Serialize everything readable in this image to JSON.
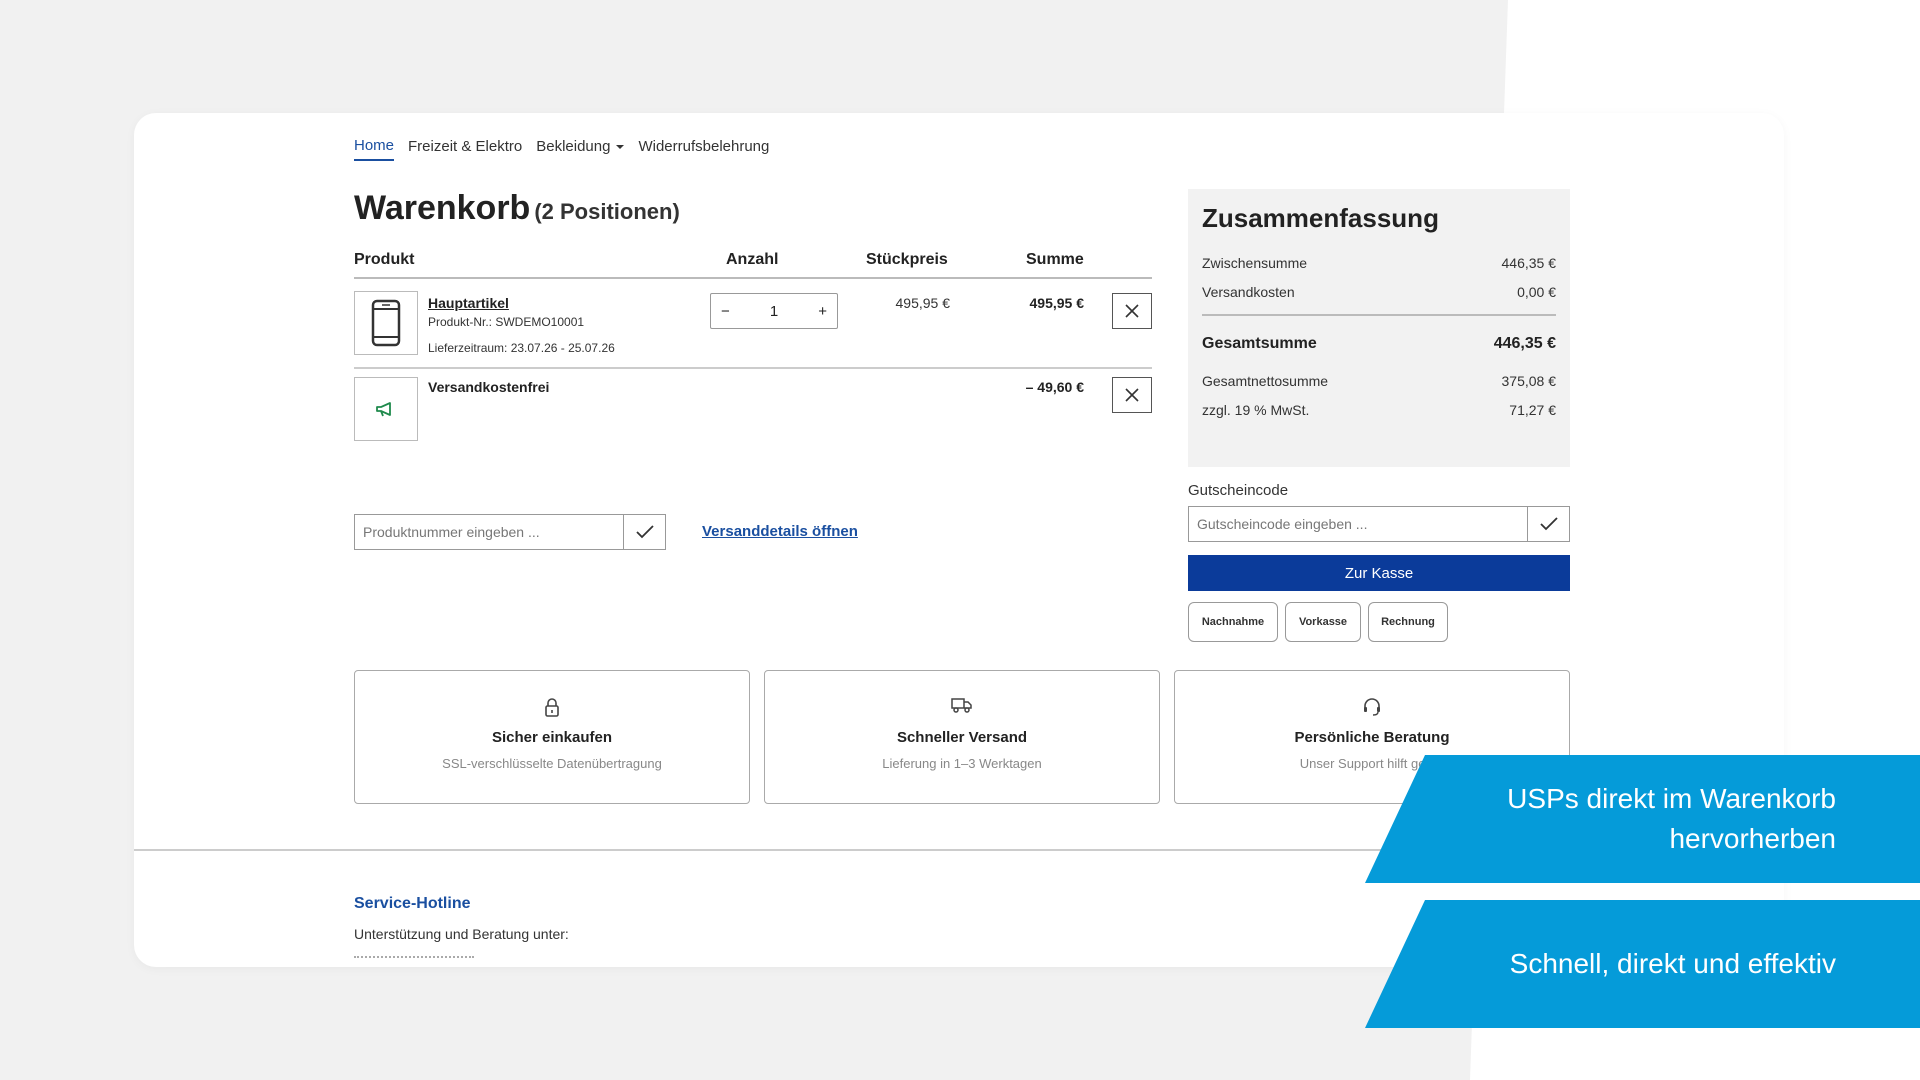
{
  "nav": [
    "Home",
    "Freizeit & Elektro",
    "Bekleidung",
    "Widerrufsbelehrung"
  ],
  "cart": {
    "title": "Warenkorb",
    "count": "(2 Positionen)",
    "columns": {
      "product": "Produkt",
      "qty": "Anzahl",
      "unit": "Stückpreis",
      "sum": "Summe"
    },
    "items": [
      {
        "name": "Hauptartikel",
        "sku": "Produkt-Nr.: SWDEMO10001",
        "delivery": "Lieferzeitraum: 23.07.26 - 25.07.26",
        "qty": "1",
        "unit": "495,95 €",
        "sum": "495,95 €"
      },
      {
        "name": "Versandkostenfrei",
        "sum": "– 49,60 €"
      }
    ],
    "product_input_placeholder": "Produktnummer eingeben ...",
    "shipping_link": "Versanddetails öffnen"
  },
  "summary": {
    "title": "Zusammenfassung",
    "rows": [
      {
        "label": "Zwischensumme",
        "value": "446,35 €"
      },
      {
        "label": "Versandkosten",
        "value": "0,00 €"
      }
    ],
    "total": {
      "label": "Gesamtsumme",
      "value": "446,35 €"
    },
    "net_rows": [
      {
        "label": "Gesamtnettosumme",
        "value": "375,08 €"
      },
      {
        "label": "zzgl. 19 % MwSt.",
        "value": "71,27 €"
      }
    ]
  },
  "voucher": {
    "label": "Gutscheincode",
    "placeholder": "Gutscheincode eingeben ..."
  },
  "checkout_label": "Zur Kasse",
  "payments": [
    "Nachnahme",
    "Vorkasse",
    "Rechnung"
  ],
  "usps": [
    {
      "icon": "lock-icon",
      "title": "Sicher einkaufen",
      "desc": "SSL-verschlüsselte Datenübertragung"
    },
    {
      "icon": "truck-icon",
      "title": "Schneller Versand",
      "desc": "Lieferung in 1–3 Werktagen"
    },
    {
      "icon": "headset-icon",
      "title": "Persönliche Beratung",
      "desc": "Unser Support hilft gerne"
    }
  ],
  "footer": {
    "hotline_title": "Service-Hotline",
    "hotline_sub": "Unterstützung und Beratung unter:"
  },
  "banners": {
    "b1_line1": "USPs direkt im Warenkorb",
    "b1_line2": "hervorherben",
    "b2": "Schnell, direkt und effektiv"
  },
  "colors": {
    "accent": "#1a4fa0",
    "checkout": "#0b3b9a",
    "banner": "#059bd9",
    "promo_icon": "#1f8a4c"
  }
}
